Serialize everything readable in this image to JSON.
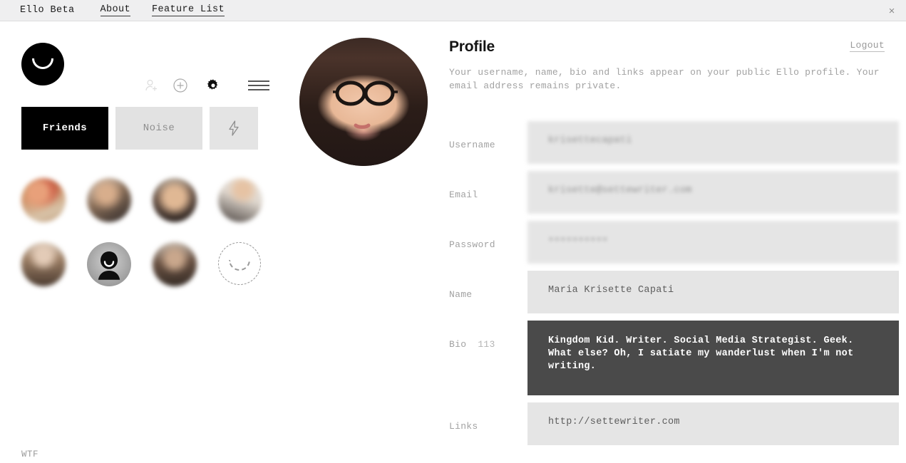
{
  "window": {
    "brand": "Ello Beta",
    "nav": [
      {
        "label": "About",
        "name": "about"
      },
      {
        "label": "Feature List",
        "name": "feature-list"
      }
    ],
    "close_glyph": "×"
  },
  "sidebar": {
    "logo_name": "ello-logo",
    "icons": [
      {
        "name": "add-person-icon",
        "state": "dim"
      },
      {
        "name": "plus-circle-icon",
        "state": "normal"
      },
      {
        "name": "gear-icon",
        "state": "active"
      },
      {
        "name": "hamburger-menu-icon",
        "state": "normal"
      }
    ],
    "tabs": [
      {
        "label": "Friends",
        "active": true
      },
      {
        "label": "Noise",
        "active": false
      },
      {
        "label": "",
        "icon": "lightning-bolt-icon",
        "active": false
      }
    ],
    "avatars": [
      {
        "type": "photo",
        "tint": "#b5634a"
      },
      {
        "type": "photo",
        "tint": "#6f5a4e"
      },
      {
        "type": "photo",
        "tint": "#7a6353"
      },
      {
        "type": "photo",
        "tint": "#c9bdb4"
      },
      {
        "type": "photo",
        "tint": "#8d7469"
      },
      {
        "type": "ello-avatar",
        "tint": "#9c9c9c"
      },
      {
        "type": "photo",
        "tint": "#5e4a3e"
      },
      {
        "type": "placeholder",
        "tint": "#9a9a9a"
      }
    ],
    "footer_link": "WTF"
  },
  "profile_photo": {
    "name": "profile-avatar-large"
  },
  "profile": {
    "title": "Profile",
    "logout_label": "Logout",
    "description": "Your username, name, bio and links appear on your public Ello profile. Your email address remains private.",
    "fields": [
      {
        "label": "Username",
        "value": "krisettecapati",
        "name": "username-field",
        "style": "blurred",
        "placeholder": "Username"
      },
      {
        "label": "Email",
        "value": "krisette@settewriter.com",
        "name": "email-field",
        "style": "blurred",
        "placeholder": "Email"
      },
      {
        "label": "Password",
        "value": "••••••••••",
        "name": "password-field",
        "style": "blurred",
        "placeholder": "Password"
      },
      {
        "label": "Name",
        "value": "Maria Krisette Capati",
        "name": "name-field",
        "style": "value",
        "placeholder": "Name"
      },
      {
        "label": "Bio",
        "count": "113",
        "value": "Kingdom Kid. Writer. Social Media Strategist. Geek. What else? Oh, I satiate my wanderlust when I'm not writing.",
        "name": "bio-field",
        "style": "dark",
        "placeholder": "Bio"
      },
      {
        "label": "Links",
        "value": "http://settewriter.com",
        "name": "links-field",
        "style": "value",
        "placeholder": "Links"
      }
    ]
  },
  "colors": {
    "topbar_bg": "#efeff0",
    "field_bg": "#e5e5e5",
    "field_focus_bg": "#4a4a4a",
    "active_tab_bg": "#000000",
    "inactive_tab_bg": "#e2e2e2",
    "muted_text": "#a2a2a2"
  }
}
